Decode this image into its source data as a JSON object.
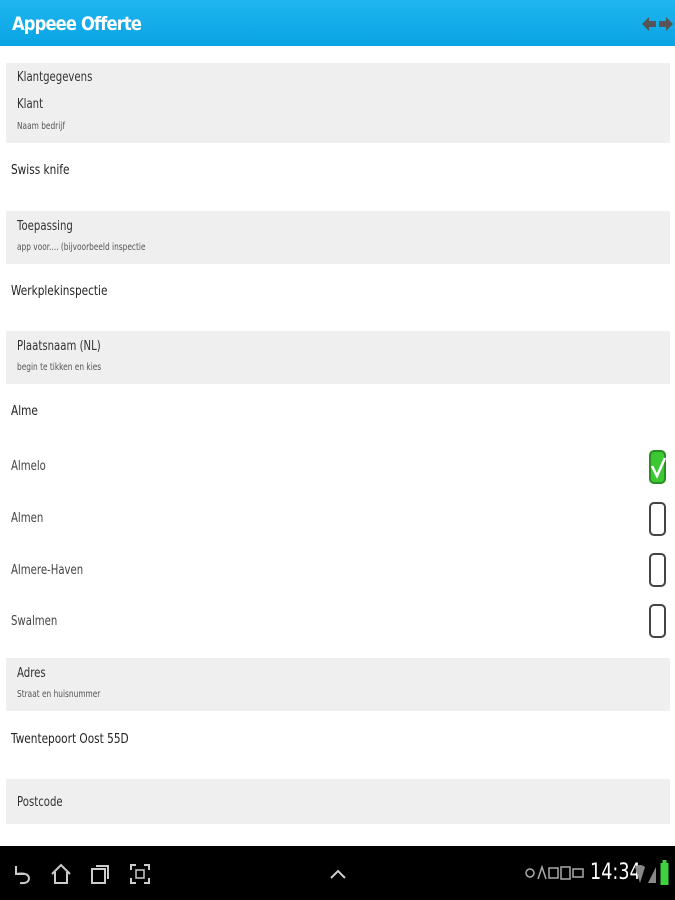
{
  "app": {
    "title": "Appeee Offerte"
  },
  "form": {
    "section_title": "Klantgegevens",
    "klant": {
      "label": "Klant",
      "hint": "Naam bedrijf",
      "value": "Swiss knife"
    },
    "toepassing": {
      "label": "Toepassing",
      "hint": "app voor.... (bijvoorbeeld inspectie",
      "value": "Werkplekinspectie"
    },
    "plaatsnaam": {
      "label": "Plaatsnaam (NL)",
      "hint": "begin te tikken en kies",
      "value": "Alme",
      "options": [
        {
          "label": "Almelo",
          "checked": true
        },
        {
          "label": "Almen",
          "checked": false
        },
        {
          "label": "Almere-Haven",
          "checked": false
        },
        {
          "label": "Swalmen",
          "checked": false
        }
      ]
    },
    "adres": {
      "label": "Adres",
      "hint": "Straat en huisnummer",
      "value": "Twentepoort Oost 55D"
    },
    "postcode": {
      "label": "Postcode"
    }
  },
  "statusbar": {
    "time": "14:34"
  },
  "colors": {
    "actionbar": "#0aa3e3",
    "checked": "#3cc733"
  }
}
